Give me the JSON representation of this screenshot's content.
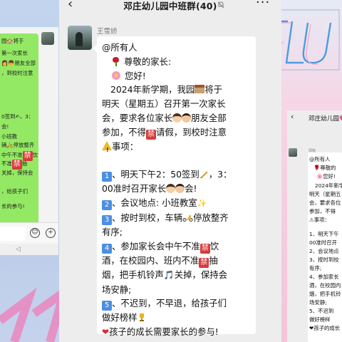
{
  "main_chat": {
    "title": "邓庄幼儿园中班群(40)",
    "sender_name": "王雪娇",
    "message_lines": [
      "@所有人",
      "尊敬的家长:",
      "您好!",
      "2024年新学期，我园",
      "将于",
      "明天（星期五）召开第一次家长",
      "会，要求各位家长",
      "朋友全部",
      "参加，不得",
      "禁",
      "请假，到校时注意",
      "事项：",
      "、明天下午2：50签到",
      "，3：",
      "00准时召开家长",
      "会!",
      "、会议地点: 小班教室",
      "、按时到校，车辆",
      "停放整齐",
      "有序;",
      "、参加家长会中午不准",
      "饮",
      "酒，在校园内、班内不准",
      "抽",
      "烟，把手机铃声",
      "关掉，保持会",
      "场安静;",
      "、不迟到，不早退，给孩子们",
      "做好榜样",
      "孩子的成长需要家长的参与!",
      "1",
      "2",
      "3",
      "4",
      "5"
    ]
  },
  "left_screenshot": {
    "lines": [
      "园",
      "将于",
      "第一次家长",
      "朋友全部",
      "，到校时注意",
      "0签到",
      "，3：",
      "会!",
      "小班教",
      "辆",
      "停放整齐",
      "中午不准",
      "饮",
      "不准",
      "抽",
      "关掉，保持会",
      "，给孩子们",
      "长的参与!"
    ]
  },
  "right_thumbnail": {
    "title": "邓庄幼儿园",
    "sender_name": "郭敏",
    "lines": [
      "@所有人",
      "尊敬的",
      "您好!",
      "2024年新学",
      "明天（星期五",
      "会，要求各位",
      "参加，不得",
      "事项：",
      "、明天下午",
      "00准时召开",
      "、会议地点",
      "、按时到校",
      "有序;",
      "、参加家长",
      "酒，在校园内",
      "烟，把手机铃",
      "场安静;",
      "、不迟到",
      "做好榜样",
      "孩子的成长",
      "1",
      "2",
      "3",
      "4",
      "5"
    ]
  },
  "icons": [
    "back-arrow-icon",
    "mute-icon",
    "more-icon",
    "rose-icon",
    "blossom-icon",
    "school-icon",
    "mother-face-icon",
    "father-face-icon",
    "forbidden-icon",
    "warning-icon",
    "pencil-icon",
    "sparkle-icon",
    "scooter-icon",
    "music-note-icon",
    "trophy-icon",
    "heart-icon",
    "emoji-icon",
    "plus-icon"
  ]
}
